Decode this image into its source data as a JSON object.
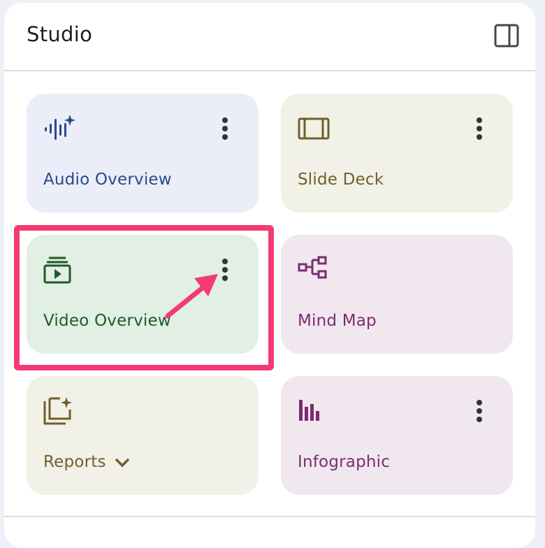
{
  "header": {
    "title": "Studio"
  },
  "cards": [
    {
      "label": "Audio Overview",
      "icon": "audio-sparkle-icon",
      "color": "#2a4a8a"
    },
    {
      "label": "Slide Deck",
      "icon": "slides-icon",
      "color": "#6f5f2c"
    },
    {
      "label": "Video Overview",
      "icon": "video-library-icon",
      "color": "#1e5a2a"
    },
    {
      "label": "Mind Map",
      "icon": "flowchart-icon",
      "color": "#7a2c72"
    },
    {
      "label": "Reports",
      "icon": "reports-sparkle-icon",
      "color": "#6f5f2c"
    },
    {
      "label": "Infographic",
      "icon": "bar-chart-icon",
      "color": "#7a2c72"
    }
  ],
  "annotation": {
    "highlight_color": "#f43a72"
  }
}
